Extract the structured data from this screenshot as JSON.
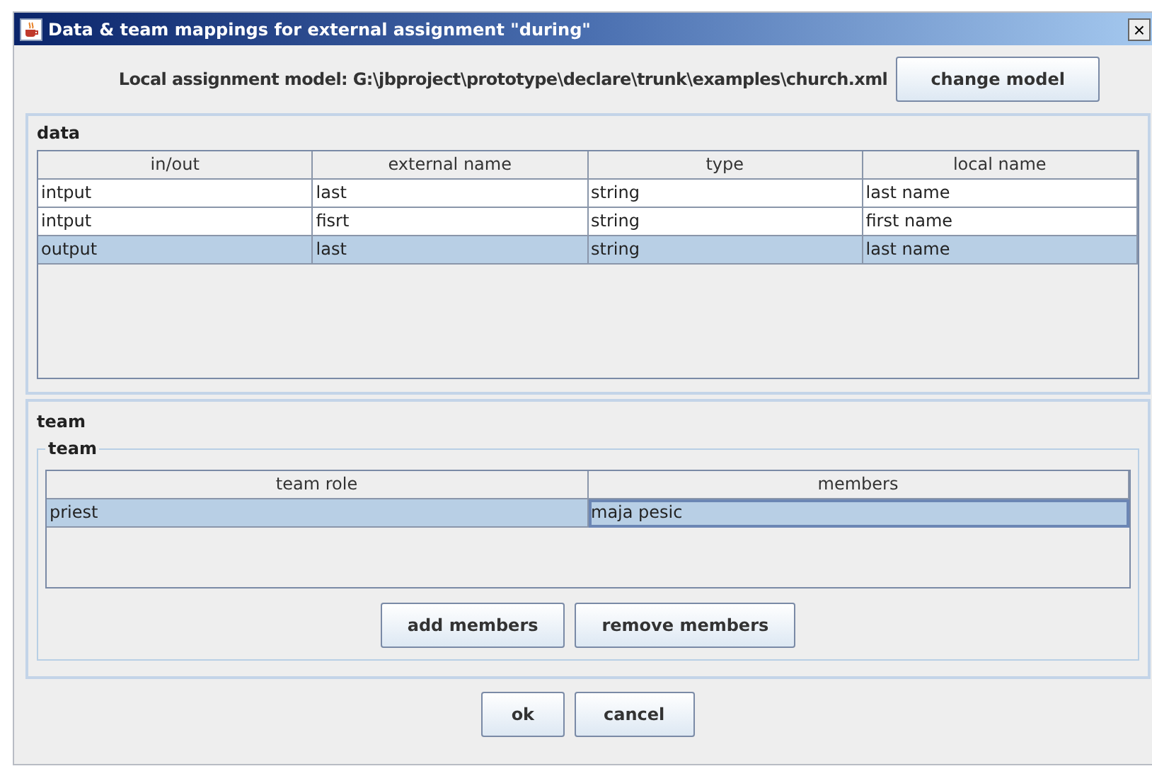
{
  "window": {
    "title": "Data & team mappings for external assignment \"during\"",
    "close": "×"
  },
  "model": {
    "label": "Local assignment model: G:\\jbproject\\prototype\\declare\\trunk\\examples\\church.xml",
    "button": "change model"
  },
  "data": {
    "title": "data",
    "columns": [
      "in/out",
      "external name",
      "type",
      "local name"
    ],
    "rows": [
      {
        "cells": [
          "intput",
          "last",
          "string",
          "last name"
        ],
        "selected": false
      },
      {
        "cells": [
          "intput",
          "fisrt",
          "string",
          "first name"
        ],
        "selected": false
      },
      {
        "cells": [
          "output",
          "last",
          "string",
          "last name"
        ],
        "selected": true
      }
    ]
  },
  "team": {
    "title": "team",
    "group_title": "team",
    "columns": [
      "team role",
      "members"
    ],
    "rows": [
      {
        "cells": [
          "priest",
          "maja pesic"
        ],
        "selected": true
      }
    ],
    "buttons": [
      "add members",
      "remove members"
    ]
  },
  "buttons": [
    "ok",
    "cancel"
  ]
}
